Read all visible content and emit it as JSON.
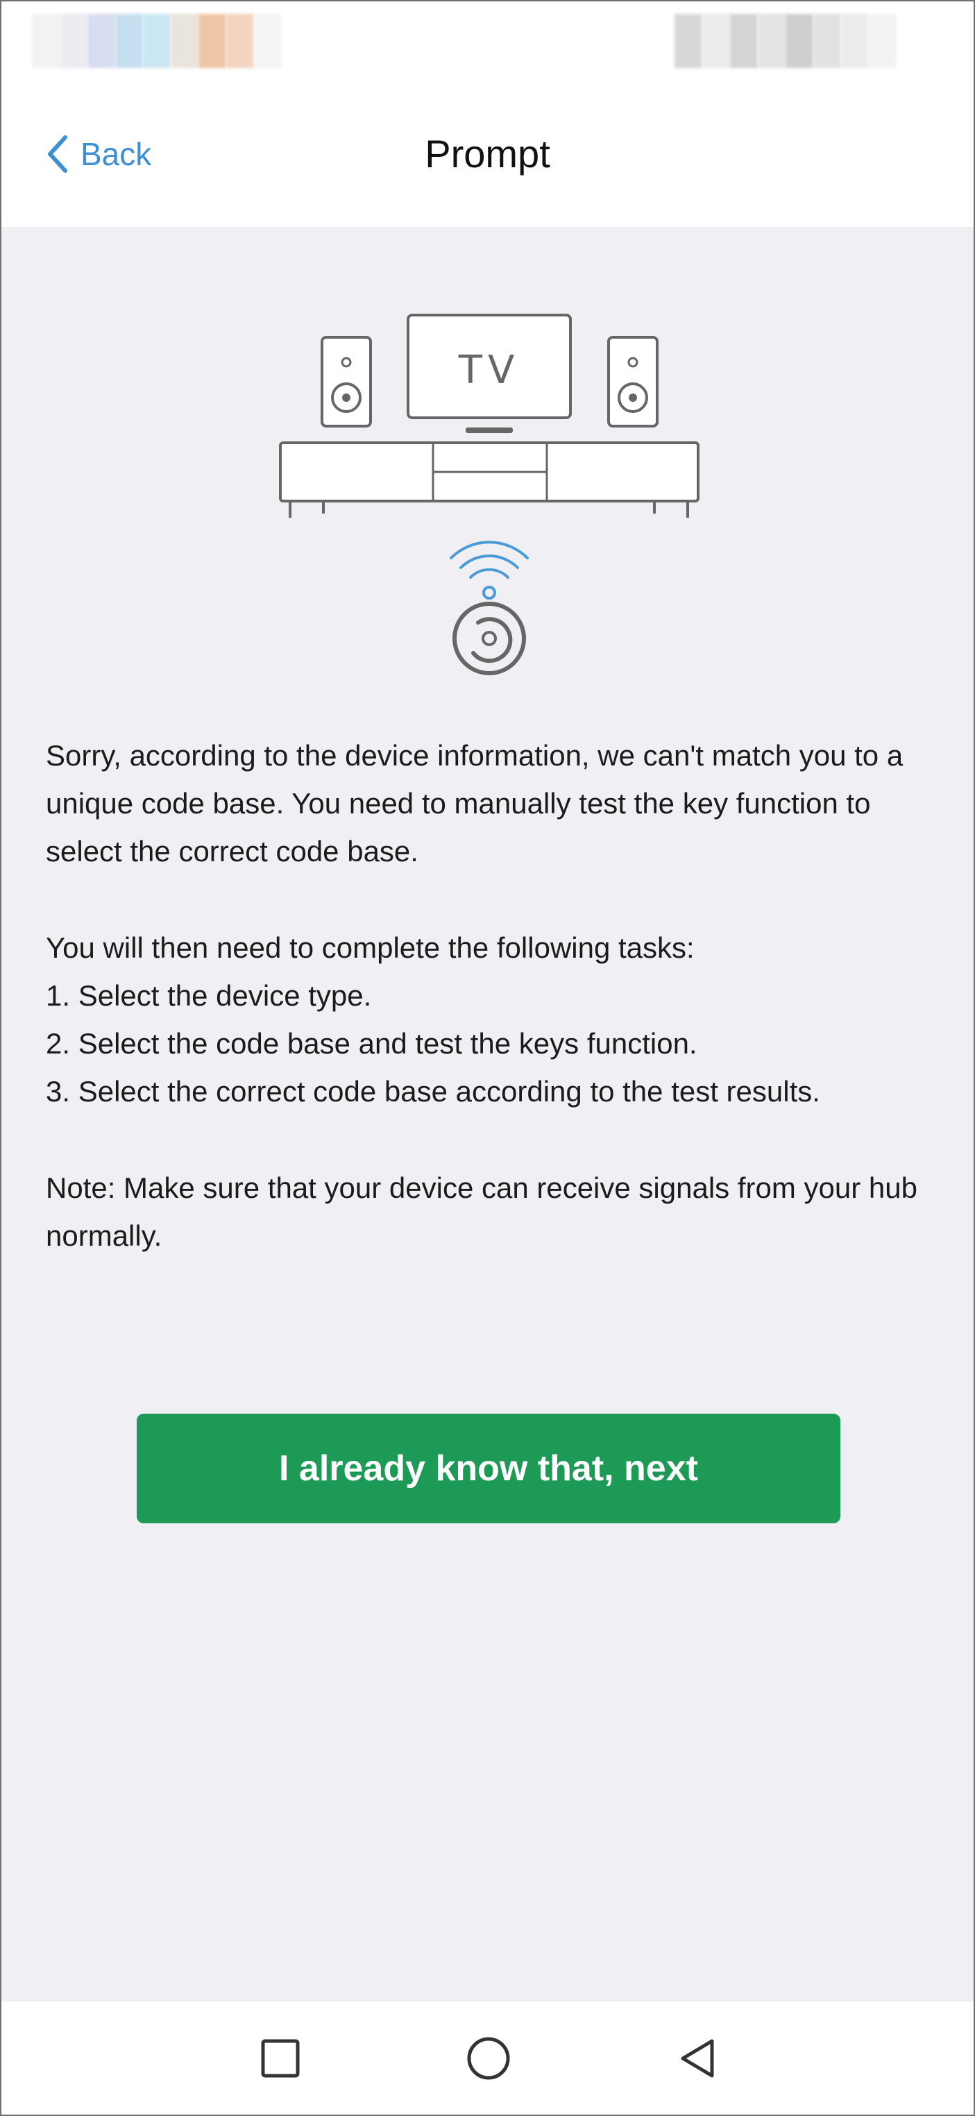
{
  "header": {
    "back_label": "Back",
    "title": "Prompt"
  },
  "illustration": {
    "tv_label": "TV"
  },
  "content": {
    "paragraph_1": "Sorry, according to the device information, we can't match you to a unique code base. You need to manually test the key function to select the correct code base.",
    "tasks_intro": "You will then need to complete the following tasks:",
    "tasks": [
      "1. Select the device type.",
      "2. Select the code base and test the keys function.",
      "3. Select the correct code base according to the test results."
    ],
    "note": "Note: Make sure that your device can receive signals from your hub normally."
  },
  "next_button": {
    "label": "I already know that, next"
  },
  "colors": {
    "accent_blue": "#3d8fd1",
    "button_green": "#1d9b56",
    "background": "#efeff4"
  },
  "icons": {
    "back": "chevron-left-icon",
    "nav_recent": "square-icon",
    "nav_home": "circle-icon",
    "nav_back": "triangle-left-icon"
  }
}
